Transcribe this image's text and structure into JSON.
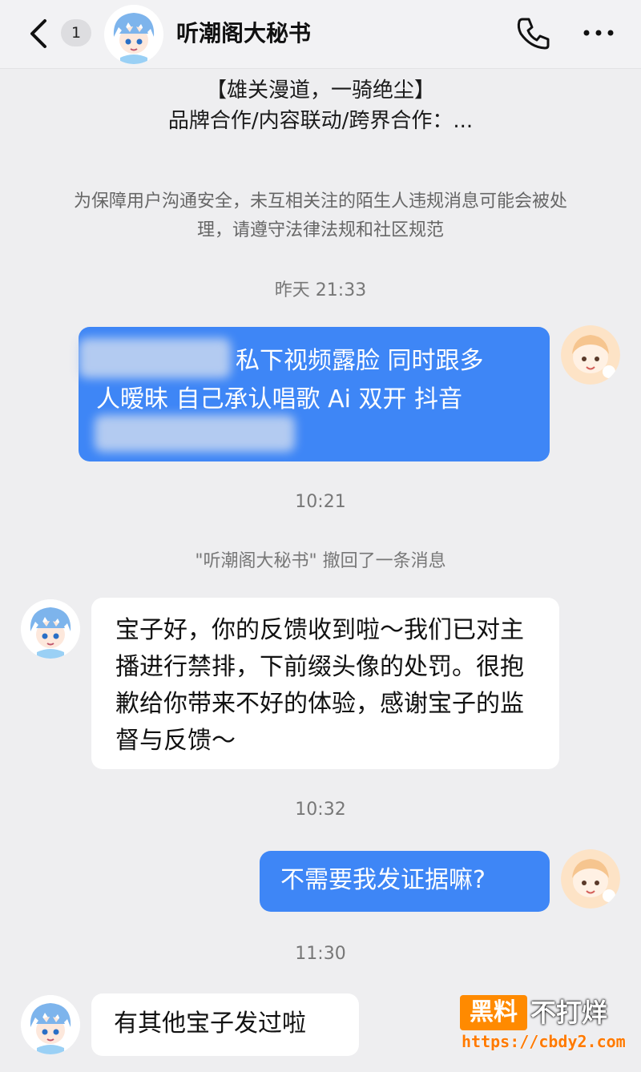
{
  "header": {
    "unread_count": "1",
    "title": "听潮阁大秘书"
  },
  "bio": {
    "line1": "【雄关漫道，一骑绝尘】",
    "line2": "品牌合作/内容联动/跨界合作：..."
  },
  "notice": {
    "text": "为保障用户沟通安全，未互相关注的陌生人违规消息可能会被处理，请遵守法律法规和社区规范"
  },
  "messages": {
    "ts1": "昨天 21:33",
    "m1_line1": "私下视频露脸 同时跟多",
    "m1_line2": "人暧昧 自己承认唱歌 Ai  双开 抖音",
    "ts2": "10:21",
    "recall": "\"听潮阁大秘书\" 撤回了一条消息",
    "m2_text": "宝子好，你的反馈收到啦～我们已对主播进行禁排，下前缀头像的处罚。很抱歉给你带来不好的体验，感谢宝子的监督与反馈～",
    "ts3": "10:32",
    "m3_text": "不需要我发证据嘛?",
    "ts4": "11:30",
    "m4_text": "有其他宝子发过啦"
  },
  "watermark": {
    "box": "黑料",
    "text": "不打烊",
    "url": "https://cbdy2.com"
  },
  "icons": [
    "back-chevron-icon",
    "phone-icon",
    "more-icon"
  ],
  "colors": {
    "outgoing_bubble": "#3e86f6",
    "incoming_bubble": "#ffffff",
    "background": "#eeeef0"
  }
}
